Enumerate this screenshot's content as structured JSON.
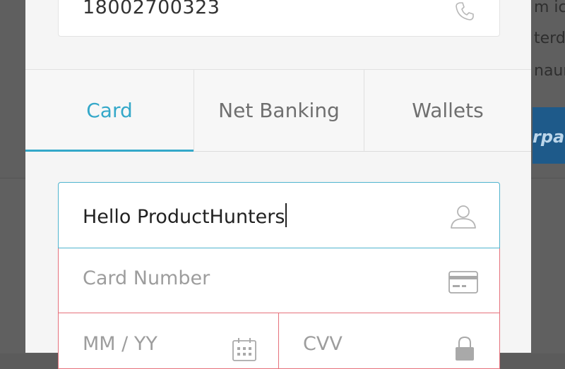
{
  "background": {
    "text_lines": [
      "m ic",
      "terd",
      "naun"
    ],
    "banner_text": "rpa"
  },
  "contact": {
    "phone_value": "18002700323",
    "phone_icon": "phone-icon"
  },
  "tabs": [
    {
      "label": "Card",
      "active": true
    },
    {
      "label": "Net Banking",
      "active": false
    },
    {
      "label": "Wallets",
      "active": false
    }
  ],
  "card_form": {
    "name_value": "Hello ProductHunters",
    "name_icon": "user-icon",
    "number_placeholder": "Card Number",
    "number_icon": "credit-card-icon",
    "expiry_placeholder": "MM / YY",
    "expiry_icon": "calendar-icon",
    "cvv_placeholder": "CVV",
    "cvv_icon": "lock-icon"
  },
  "colors": {
    "accent": "#34a8c9",
    "error_border": "#e6717b",
    "overlay_background": "#5f5f5f"
  }
}
